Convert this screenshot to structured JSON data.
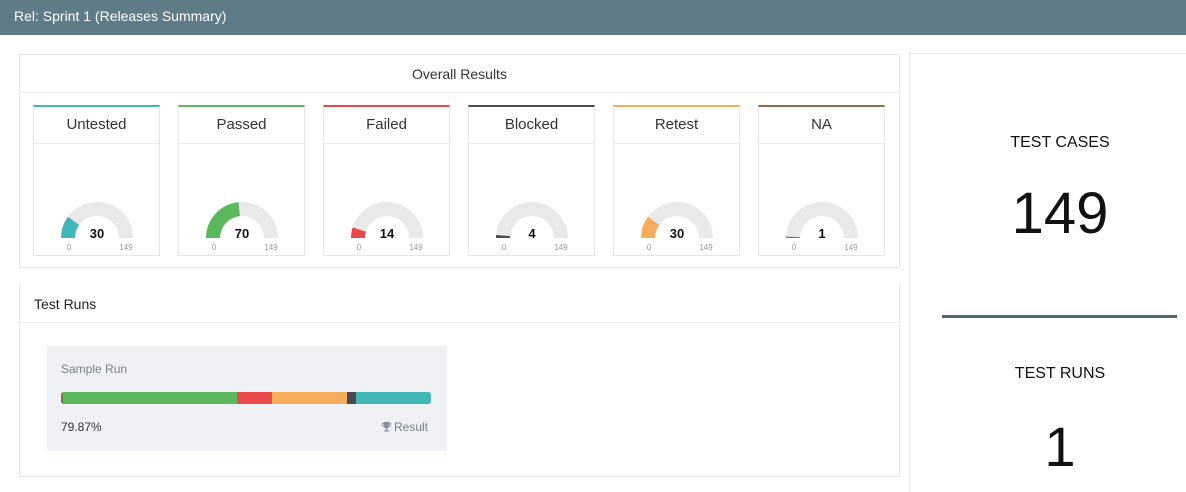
{
  "header": {
    "title": "Rel: Sprint 1 (Releases Summary)"
  },
  "overall": {
    "title": "Overall Results",
    "total": 149,
    "min_label": "0",
    "max_label": "149",
    "statuses": [
      {
        "label": "Untested",
        "value": 30,
        "color": "#42b7b7"
      },
      {
        "label": "Passed",
        "value": 70,
        "color": "#5cb85c"
      },
      {
        "label": "Failed",
        "value": 14,
        "color": "#e8494b"
      },
      {
        "label": "Blocked",
        "value": 4,
        "color": "#4a4a55"
      },
      {
        "label": "Retest",
        "value": 30,
        "color": "#f6ad5b"
      },
      {
        "label": "NA",
        "value": 1,
        "color": "#8b6f47"
      }
    ]
  },
  "test_runs": {
    "title": "Test Runs",
    "runs": [
      {
        "name": "Sample Run",
        "percent": "79.87%",
        "result_label": "Result",
        "segments": [
          {
            "status": "NA",
            "value": 1,
            "color": "#8b6f47"
          },
          {
            "status": "Passed",
            "value": 70,
            "color": "#5cb85c"
          },
          {
            "status": "Failed",
            "value": 14,
            "color": "#e8494b"
          },
          {
            "status": "Retest",
            "value": 30,
            "color": "#f6ad5b"
          },
          {
            "status": "Blocked",
            "value": 4,
            "color": "#4a4a55"
          },
          {
            "status": "Untested",
            "value": 30,
            "color": "#42b7b7"
          }
        ]
      }
    ]
  },
  "summary": {
    "test_cases_label": "TEST CASES",
    "test_cases_value": "149",
    "test_runs_label": "TEST RUNS",
    "test_runs_value": "1"
  },
  "icons": {
    "result": "trophy-icon"
  }
}
